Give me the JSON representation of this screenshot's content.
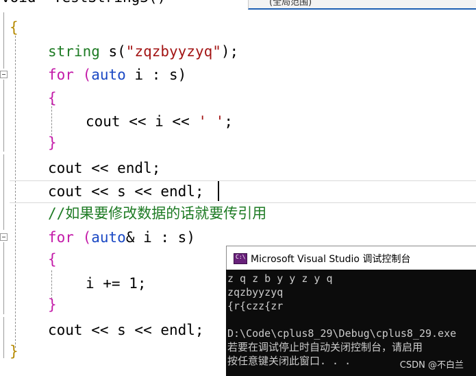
{
  "editor": {
    "top_fragment": "void  TestString3()",
    "tab_fragment": "(全局范围)",
    "lines": {
      "l1": "{",
      "l2a": "string",
      "l2b": " s(",
      "l2c": "\"zqzbyyzyq\"",
      "l2d": ");",
      "l3a": "for",
      "l3b": " (",
      "l3c": "auto",
      "l3d": " i : s)",
      "l4": "{",
      "l5a": "cout << i << ",
      "l5b": "' '",
      "l5c": ";",
      "l6": "}",
      "l7": "cout << endl;",
      "l8": "cout << s << endl;",
      "l9": "//如果要修改数据的话就要传引用",
      "l10a": "for",
      "l10b": " (",
      "l10c": "auto",
      "l10d": "& i : s)",
      "l11": "{",
      "l12": "i += 1;",
      "l13": "}",
      "l14": "cout << s << endl;",
      "l15": "}"
    }
  },
  "console": {
    "title": "Microsoft Visual Studio 调试控制台",
    "lines": [
      "z q z b y y z y q",
      "zqzbyyzyq",
      "{r{czz{zr",
      "",
      "D:\\Code\\cplus8_29\\Debug\\cplus8_29.exe",
      "若要在调试停止时自动关闭控制台，请启用",
      "按任意键关闭此窗口. . ."
    ]
  },
  "watermark": "CSDN @不白兰"
}
